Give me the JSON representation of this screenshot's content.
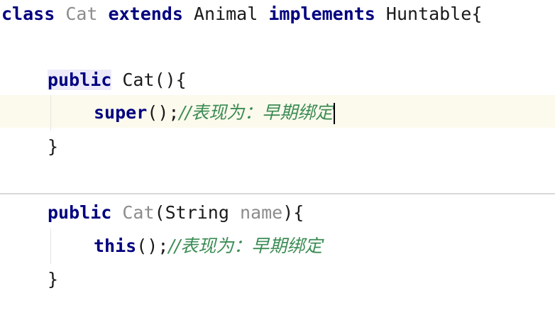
{
  "editor": {
    "lines": {
      "l1": {
        "kw_class": "class",
        "class_name": "Cat",
        "kw_extends": "extends",
        "parent": "Animal",
        "kw_implements": "implements",
        "iface": "Huntable{"
      },
      "l2": {
        "kw_public": "public",
        "ctor_name": "Cat(){"
      },
      "l3": {
        "kw_super": "super",
        "call": "();",
        "comment": "//表现为：早期绑定"
      },
      "l4": {
        "close": "}"
      },
      "l5": {
        "kw_public": "public",
        "ctor_name": "Cat",
        "paren_open": "(",
        "param_type": "String",
        "param_name": "name",
        "paren_close": "){"
      },
      "l6": {
        "kw_this": "this",
        "call": "();",
        "comment": "//表现为：早期绑定"
      },
      "l7": {
        "close": "}"
      }
    }
  },
  "colors": {
    "keyword": "#00007f",
    "comment": "#3b8c54",
    "unused": "#8c8c8c",
    "current_line": "#fcfaed"
  }
}
